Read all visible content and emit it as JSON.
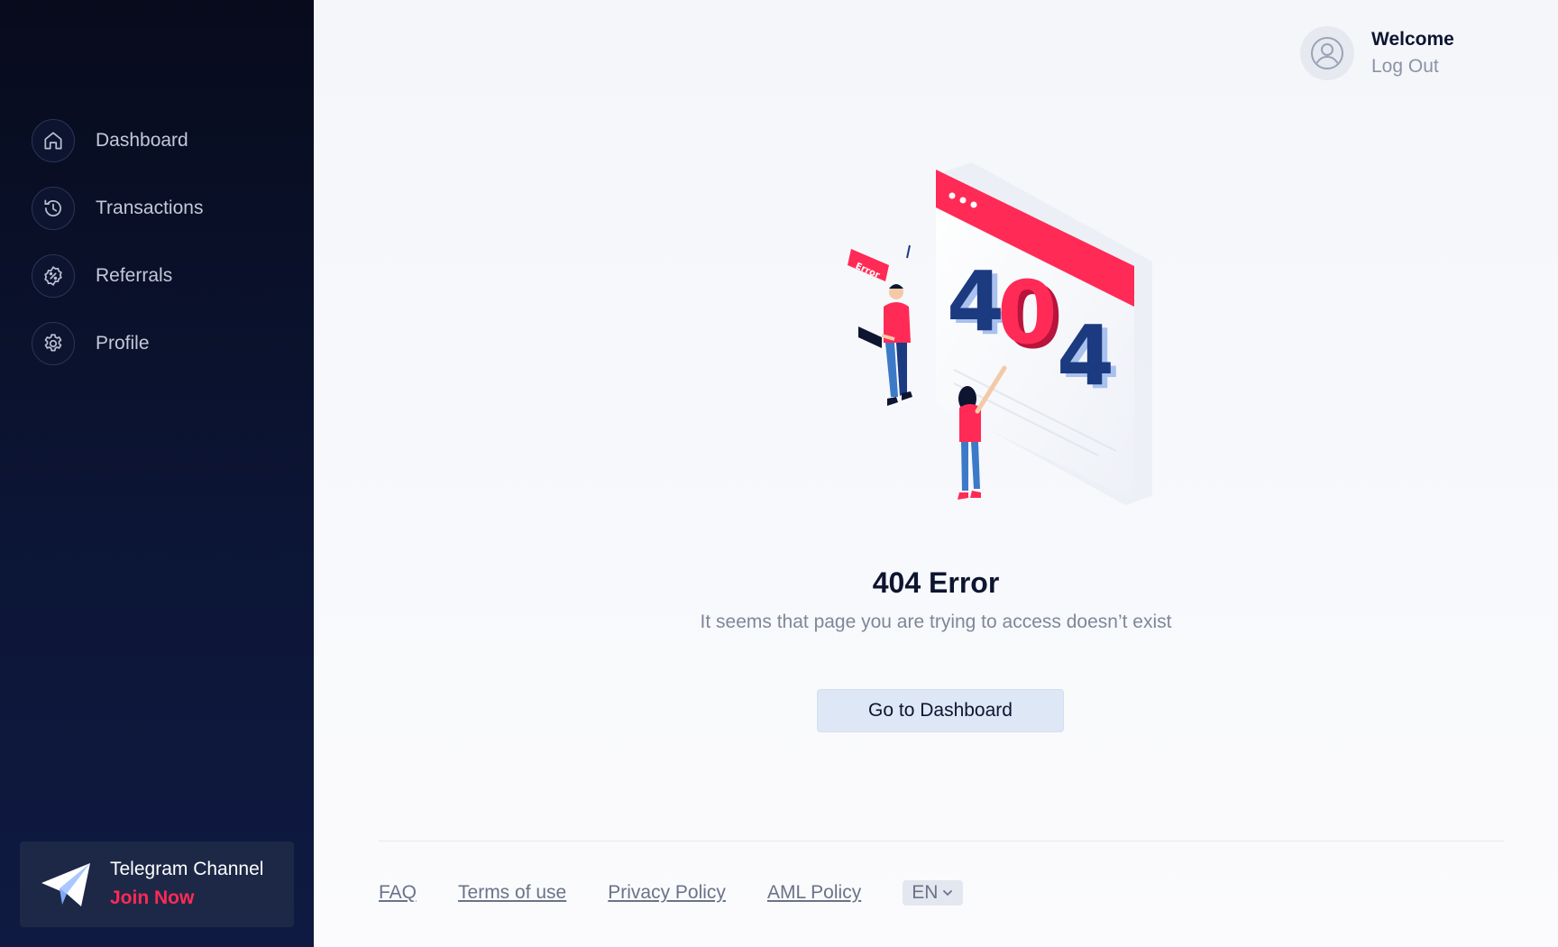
{
  "sidebar": {
    "items": [
      {
        "label": "Dashboard",
        "icon": "home-icon"
      },
      {
        "label": "Transactions",
        "icon": "history-icon"
      },
      {
        "label": "Referrals",
        "icon": "percent-badge-icon"
      },
      {
        "label": "Profile",
        "icon": "gear-icon"
      }
    ],
    "telegram": {
      "title": "Telegram Channel",
      "cta": "Join Now",
      "icon": "paper-plane-icon"
    }
  },
  "header": {
    "welcome": "Welcome",
    "logout": "Log Out",
    "avatar_icon": "user-circle-icon"
  },
  "main": {
    "illustration": {
      "badge": "Error",
      "digits": [
        "4",
        "0",
        "4"
      ]
    },
    "title": "404 Error",
    "subtitle": "It seems that page you are trying to access doesn’t exist",
    "button": "Go to Dashboard"
  },
  "footer": {
    "links": [
      "FAQ",
      "Terms of use",
      "Privacy Policy",
      "AML Policy"
    ],
    "language": "EN"
  },
  "colors": {
    "accent": "#ff2a55",
    "navy": "#1b3a80",
    "sidebar_bg": "#0c1535",
    "button_bg": "#dee7f5"
  }
}
